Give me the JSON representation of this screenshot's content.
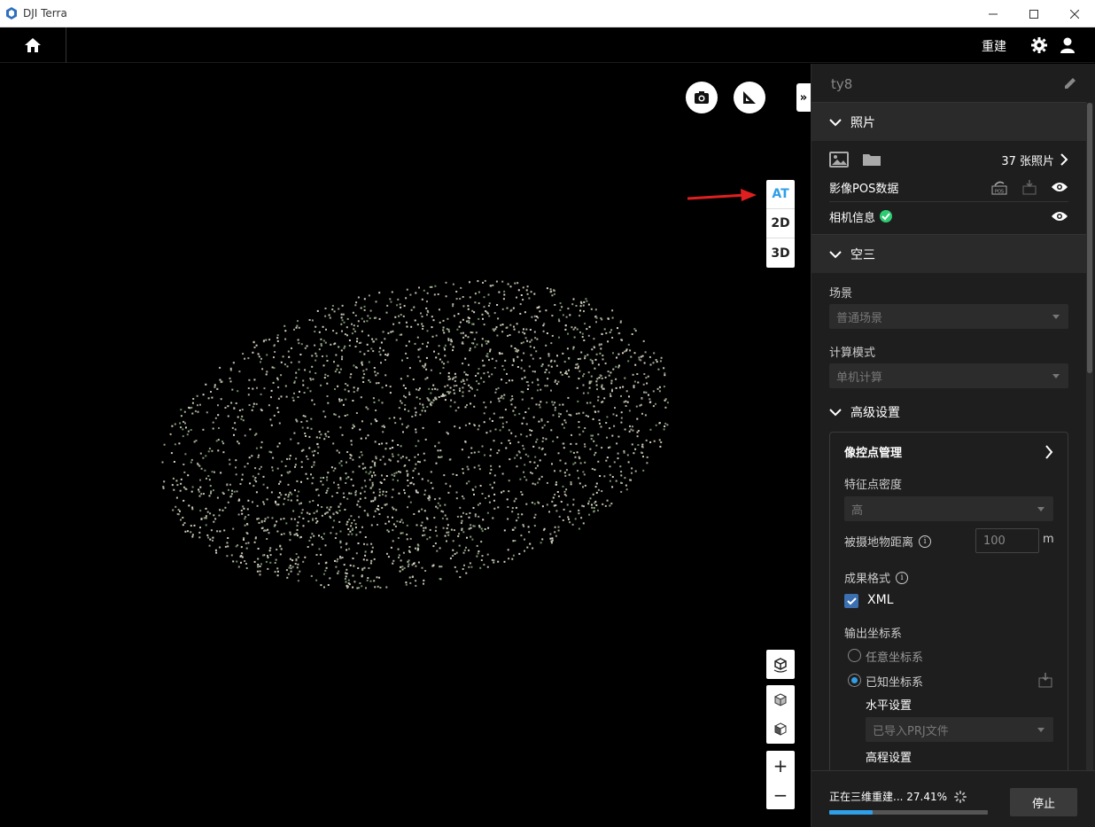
{
  "window": {
    "title": "DJI Terra"
  },
  "topbar": {
    "rebuild_label": "重建"
  },
  "viewport": {
    "modes": [
      "AT",
      "2D",
      "3D"
    ],
    "active_mode": "AT",
    "zoom_in": "+",
    "zoom_out": "−",
    "collapse_glyph": "»"
  },
  "panel": {
    "project_name": "ty8",
    "photos": {
      "title": "照片",
      "count_label": "37 张照片",
      "pos_label": "影像POS数据",
      "camera_label": "相机信息"
    },
    "aerotriangulation": {
      "title": "空三",
      "scene_label": "场景",
      "scene_value": "普通场景",
      "mode_label": "计算模式",
      "mode_value": "单机计算"
    },
    "advanced": {
      "title": "高级设置",
      "gcp_label": "像控点管理",
      "density_label": "特征点密度",
      "density_value": "高",
      "distance_label": "被摄地物距离",
      "distance_value": "100",
      "distance_unit": "m",
      "format_label": "成果格式",
      "format_xml": "XML",
      "output_crs_label": "输出坐标系",
      "crs_any": "任意坐标系",
      "crs_known": "已知坐标系",
      "horizontal_label": "水平设置",
      "horizontal_value": "已导入PRJ文件",
      "elevation_label": "高程设置"
    },
    "footer": {
      "status_text": "正在三维重建... 27.41%",
      "progress_fraction": 0.2741,
      "stop_label": "停止"
    }
  },
  "colors": {
    "accent": "#2f9fe8",
    "check_green": "#2ecc71",
    "arrow_red": "#e02020"
  }
}
